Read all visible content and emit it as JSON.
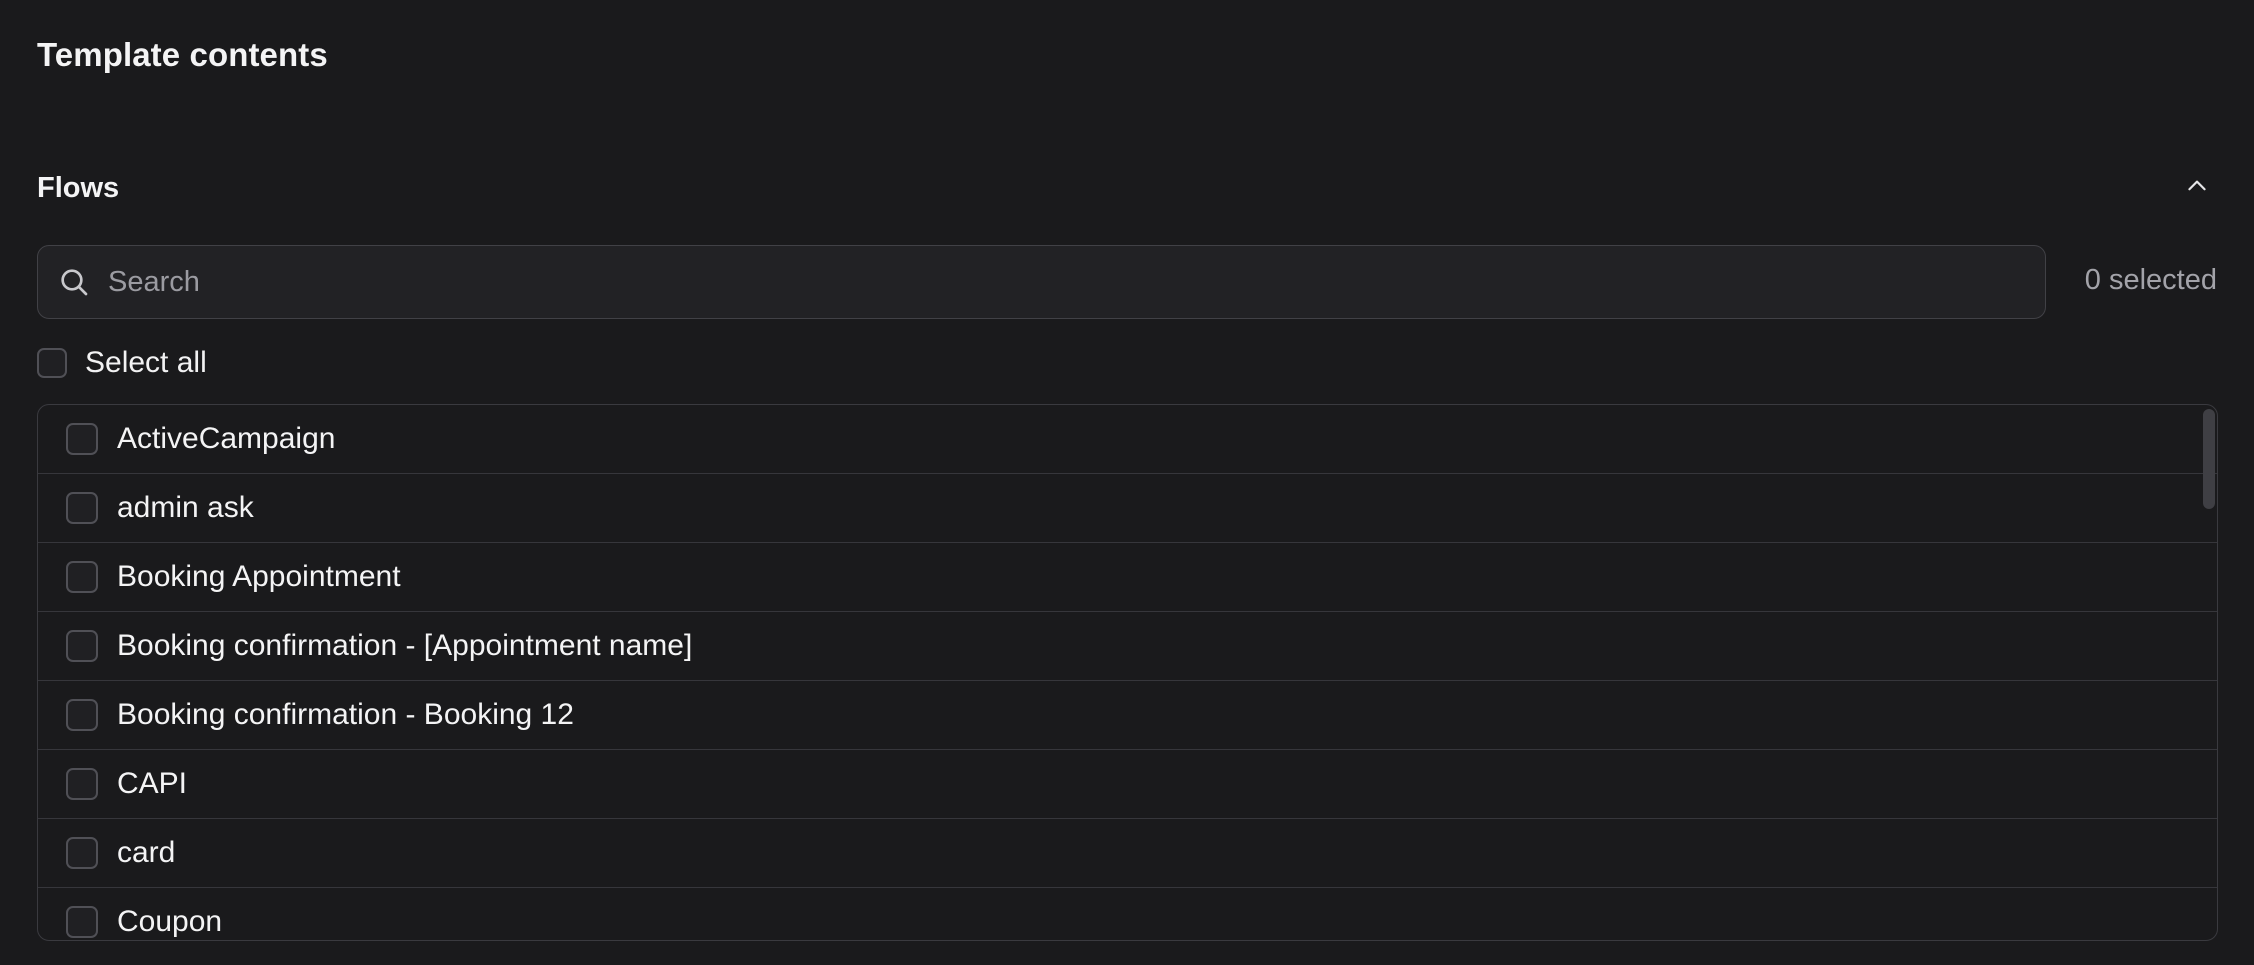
{
  "page": {
    "title": "Template contents"
  },
  "flows_section": {
    "title": "Flows",
    "collapse_icon": "chevron-up-icon",
    "search": {
      "placeholder": "Search",
      "value": "",
      "icon": "search-icon"
    },
    "selected_count": "0 selected",
    "select_all_label": "Select all",
    "select_all_checked": false,
    "items": [
      {
        "label": "ActiveCampaign",
        "checked": false
      },
      {
        "label": "admin ask",
        "checked": false
      },
      {
        "label": "Booking Appointment",
        "checked": false
      },
      {
        "label": "Booking confirmation - [Appointment name]",
        "checked": false
      },
      {
        "label": "Booking confirmation - Booking 12",
        "checked": false
      },
      {
        "label": "CAPI",
        "checked": false
      },
      {
        "label": "card",
        "checked": false
      },
      {
        "label": "Coupon",
        "checked": false
      }
    ]
  },
  "colors": {
    "background": "#1a1a1c",
    "surface": "#222225",
    "border": "#414146",
    "text_primary": "#f4f4f5",
    "text_muted": "#a3a3a9"
  }
}
